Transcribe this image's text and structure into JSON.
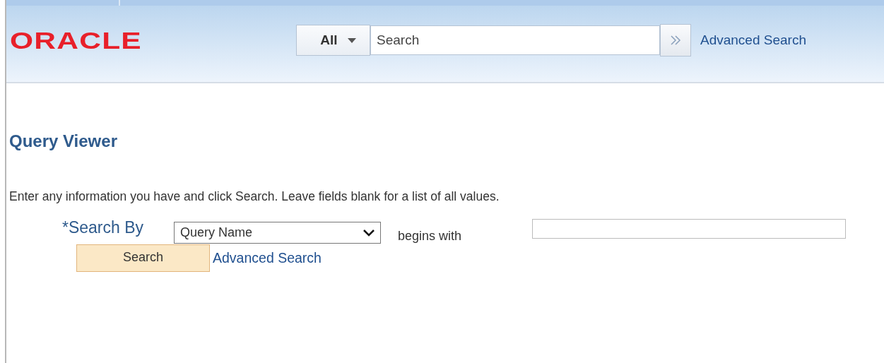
{
  "header": {
    "logo": "ORACLE",
    "search": {
      "scope": "All",
      "placeholder": "Search",
      "advanced_link": "Advanced Search"
    }
  },
  "page": {
    "title": "Query Viewer",
    "instructions": "Enter any information you have and click Search. Leave fields blank for a list of all values.",
    "search_by": {
      "label": "*Search By",
      "field": "Query Name",
      "operator": "begins with"
    },
    "buttons": {
      "search": "Search",
      "advanced_link": "Advanced Search"
    }
  }
}
